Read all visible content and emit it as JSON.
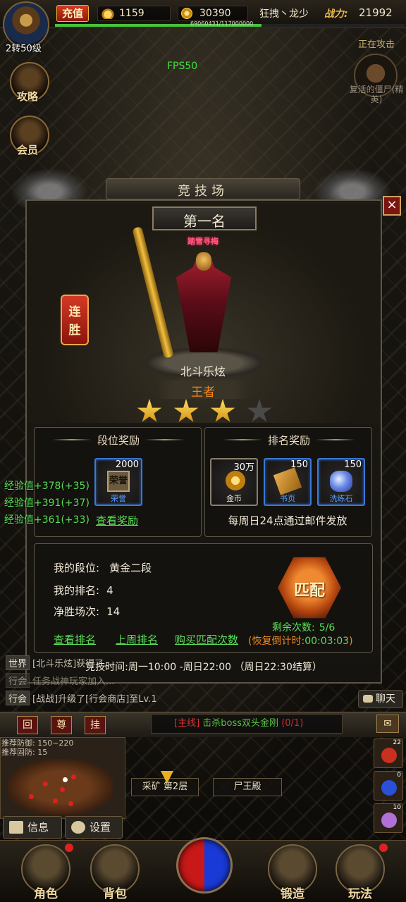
{
  "player": {
    "level": "2转50级",
    "recharge": "充值",
    "ingots": "1159",
    "gold": "30390",
    "name": "狂拽丶龙少",
    "power_label": "战力:",
    "power": "21992",
    "xp_text": "69060431/117000000",
    "xp_fraction": 0.59
  },
  "hud": {
    "fps": "FPS50",
    "attacking": "正在攻击",
    "target_name": "复活的僵尸(精英)",
    "side_buttons": [
      {
        "label": "攻略",
        "icon": "guide-icon"
      },
      {
        "label": "会员",
        "icon": "vip-icon"
      }
    ],
    "xp_gains": [
      "经验值+378(+35)",
      "经验值+391(+37)",
      "经验值+361(+33)"
    ]
  },
  "arena": {
    "title": "竞技场",
    "close": "×",
    "rank_title": "第一名",
    "title_tag": "踏雪寻梅",
    "streak": [
      "连",
      "胜"
    ],
    "player_name": "北斗乐炫",
    "tier": "王者",
    "stars_lit": 3,
    "stars_total": 4,
    "tier_rewards": {
      "title": "段位奖励",
      "items": [
        {
          "qty": "2000",
          "name": "荣誉",
          "pic": "荣誉",
          "name_color": "#58a0ff"
        }
      ],
      "view_link": "查看奖励"
    },
    "rank_rewards": {
      "title": "排名奖励",
      "items": [
        {
          "qty": "30万",
          "name": "金币",
          "name_color": "#f0e8d8"
        },
        {
          "qty": "150",
          "name": "书页",
          "name_color": "#58a0ff"
        },
        {
          "qty": "150",
          "name": "洗练石",
          "name_color": "#58a0ff"
        }
      ],
      "note": "每周日24点通过邮件发放"
    },
    "my_tier_label": "我的段位:",
    "my_tier": "黄金二段",
    "my_rank_label": "我的排名:",
    "my_rank": "4",
    "net_wins_label": "净胜场次:",
    "net_wins": "14",
    "match_button": "匹配",
    "links": [
      "查看排名",
      "上周排名",
      "购买匹配次数"
    ],
    "remaining_label": "剩余次数:",
    "remaining": "5/6",
    "recover_label": "(恢复倒计时:",
    "recover_time": "00:03:03",
    "recover_end": ")",
    "schedule": "竞技时间:周一10:00 -周日22:00 （周日22:30结算）"
  },
  "chat": {
    "lines": [
      {
        "channel": "世界",
        "text": "[北斗乐炫]获得了..."
      },
      {
        "channel": "行会",
        "text": "任务战神玩家加入..."
      },
      {
        "channel": "行会",
        "text": "[战战]升级了[行会商店]至Lv.1"
      }
    ],
    "button": "聊天"
  },
  "quickbar": {
    "buttons": [
      "回",
      "尊",
      "挂"
    ],
    "quest_tag": "[主线]",
    "quest_task": "击杀boss双头金刚",
    "quest_progress": "(0/1)",
    "mail": "✉"
  },
  "map": {
    "recommend_def": "推荐防御: 150~220",
    "recommend_mdef": "推荐固防: 15",
    "nav_from": "采矿 第2层",
    "nav_to": "尸王殿",
    "info_button": "信息",
    "settings_button": "设置"
  },
  "slots": [
    {
      "qty": "22",
      "color": "#c83020"
    },
    {
      "qty": "0",
      "color": "#2a50d8"
    },
    {
      "qty": "10",
      "color": "#b070d8"
    }
  ],
  "menu": [
    "角色",
    "背包",
    "锻造",
    "玩法"
  ]
}
